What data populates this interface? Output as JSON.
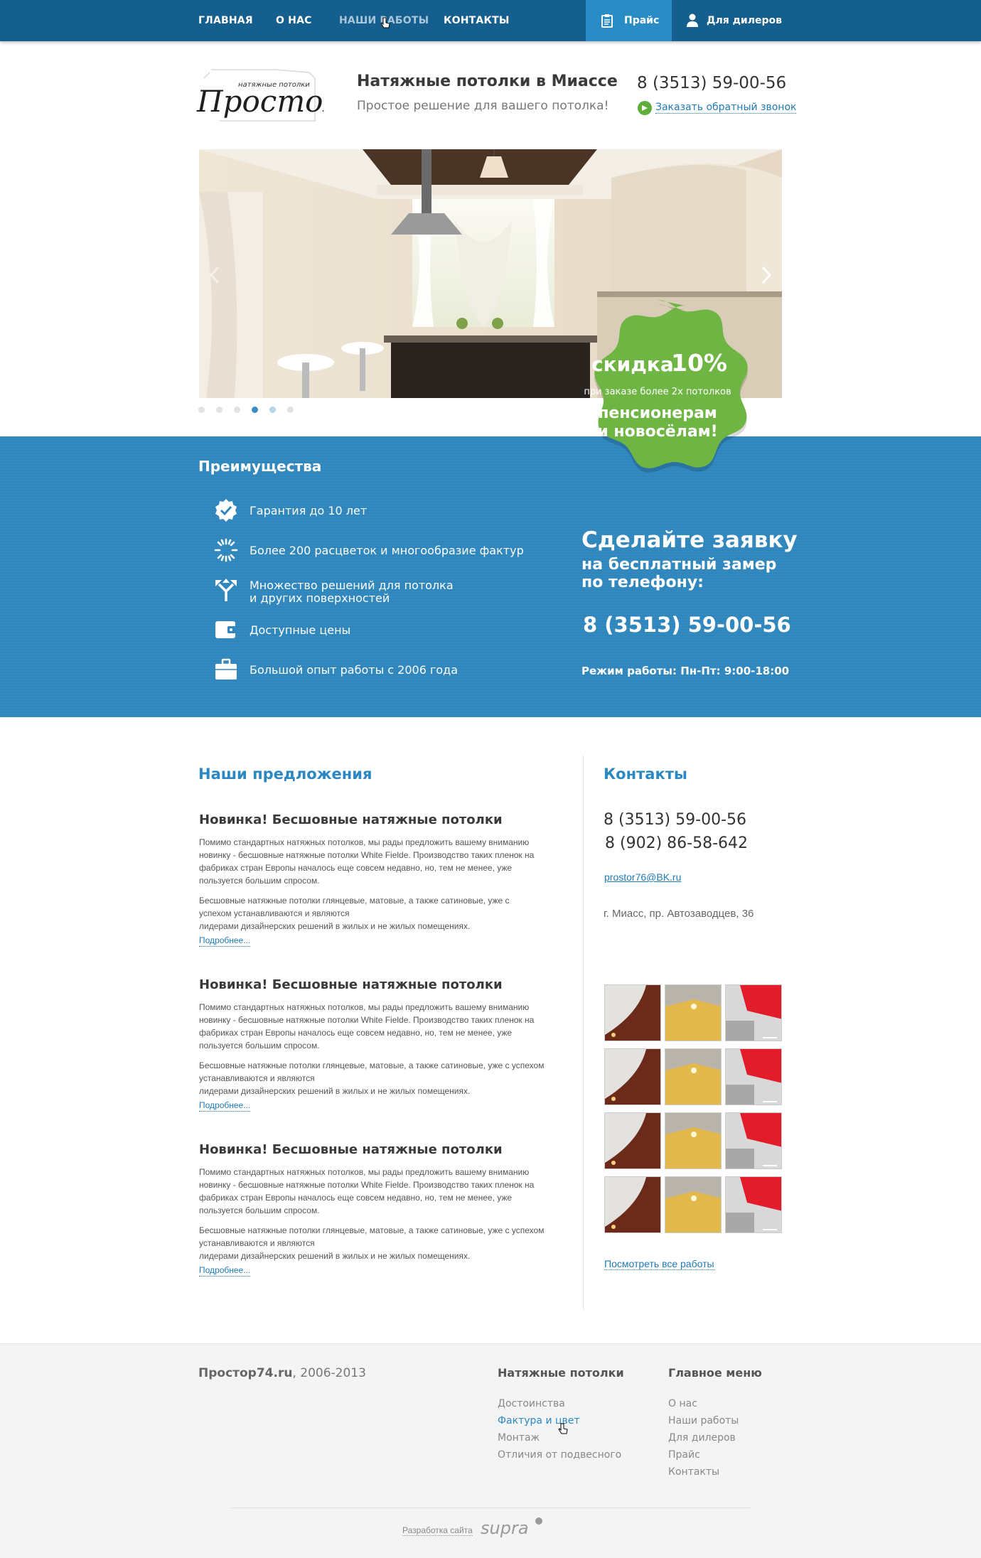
{
  "nav": {
    "items": [
      "Главная",
      "О нас",
      "Наши работы",
      "Контакты"
    ],
    "price": "Прайс",
    "dealers": "Для дилеров"
  },
  "header": {
    "logo_text": "ПростоР",
    "logo_small": "натяжные потолки",
    "title": "Натяжные потолки в Миассе",
    "subtitle": "Простое решение для вашего потолка!",
    "phone": "8 (3513) 59-00-56",
    "callback": "Заказать обратный звонок"
  },
  "slider": {
    "active_dot": 4,
    "dot_count": 6
  },
  "badge": {
    "line1": "скидка",
    "percent": "10%",
    "line2": "при заказе более 2х потолков",
    "line3": "пенсионерам",
    "line4": "и новосёлам!"
  },
  "advantages": {
    "title": "Преимущества",
    "items": [
      {
        "icon": "check-badge-icon",
        "text": "Гарантия до 10 лет"
      },
      {
        "icon": "color-wheel-icon",
        "text": "Более 200 расцветок и многообразие фактур"
      },
      {
        "icon": "arrows-split-icon",
        "text_1": "Множество решений для потолка",
        "text_2": "и других поверхностей"
      },
      {
        "icon": "wallet-icon",
        "text": "Доступные цены"
      },
      {
        "icon": "briefcase-icon",
        "text": "Большой опыт работы с 2006 года"
      }
    ]
  },
  "order": {
    "title": "Сделайте заявку",
    "sub_1": "на бесплатный замер",
    "sub_2": "по телефону:",
    "phone": "8 (3513) 59-00-56",
    "hours": "Режим работы: Пн-Пт: 9:00-18:00"
  },
  "offers": {
    "title": "Наши предложения",
    "items": [
      {
        "title": "Новинка! Бесшовные натяжные потолки",
        "p1": [
          "Помимо стандартных натяжных потолков, мы рады предложить вашему вниманию",
          "новинку - бесшовные натяжные потолки White Fielde. Производство таких пленок на",
          "фабриках стран Европы началось еще совсем недавно, но, тем не менее, уже",
          "пользуется большим спросом."
        ],
        "p2": [
          "Бесшовные натяжные потолки глянцевые, матовые, а также сатиновые, уже с",
          "успехом устанавливаются и являются",
          "лидерами дизайнерских решений в жилых и не жилых помещениях."
        ],
        "more": "Подробнее..."
      },
      {
        "title": "Новинка! Бесшовные натяжные потолки",
        "p1": [
          "Помимо стандартных натяжных потолков, мы рады предложить вашему вниманию",
          "новинку - бесшовные натяжные потолки White Fielde. Производство таких пленок на",
          "фабриках стран Европы началось еще совсем недавно, но, тем не менее, уже",
          "пользуется большим спросом."
        ],
        "p2": [
          "Бесшовные натяжные потолки глянцевые, матовые, а также сатиновые, уже с успехом",
          "устанавливаются и являются",
          "лидерами дизайнерских решений в жилых и не жилых помещениях."
        ],
        "more": "Подробнее..."
      },
      {
        "title": "Новинка! Бесшовные натяжные потолки",
        "p1": [
          "Помимо стандартных натяжных потолков, мы рады предложить вашему вниманию",
          "новинку - бесшовные натяжные потолки White Fielde. Производство таких пленок на",
          "фабриках стран Европы началось еще совсем недавно, но, тем не менее, уже",
          "пользуется большим спросом."
        ],
        "p2": [
          "Бесшовные натяжные потолки глянцевые, матовые, а также сатиновые, уже с успехом",
          "устанавливаются и являются",
          "лидерами дизайнерских решений в жилых и не жилых помещениях."
        ],
        "more": "Подробнее..."
      }
    ]
  },
  "contacts": {
    "title": "Контакты",
    "phone_1": "8 (3513) 59-00-56",
    "phone_2": "8 (902) 86-58-642",
    "email": "prostor76@BK.ru",
    "address": "г. Миасс, пр. Автозаводцев, 36",
    "all_works": "Посмотреть все работы"
  },
  "footer": {
    "site": "Простор74.ru",
    "years": ", 2006-2013",
    "col1_title": "Натяжные потолки",
    "col1_links": [
      "Достоинства",
      "Фактура и цвет",
      "Монтаж",
      "Отличия от подвесного"
    ],
    "col2_title": "Главное меню",
    "col2_links": [
      "О нас",
      "Наши работы",
      "Для дилеров",
      "Прайс",
      "Контакты"
    ],
    "dev_label": "Разработка сайта",
    "dev_logo": "supra"
  },
  "colors": {
    "nav_bg": "#145f8d",
    "accent": "#2b88c3",
    "band_bg": "#2e86bd",
    "badge_green": "#6fb544"
  }
}
